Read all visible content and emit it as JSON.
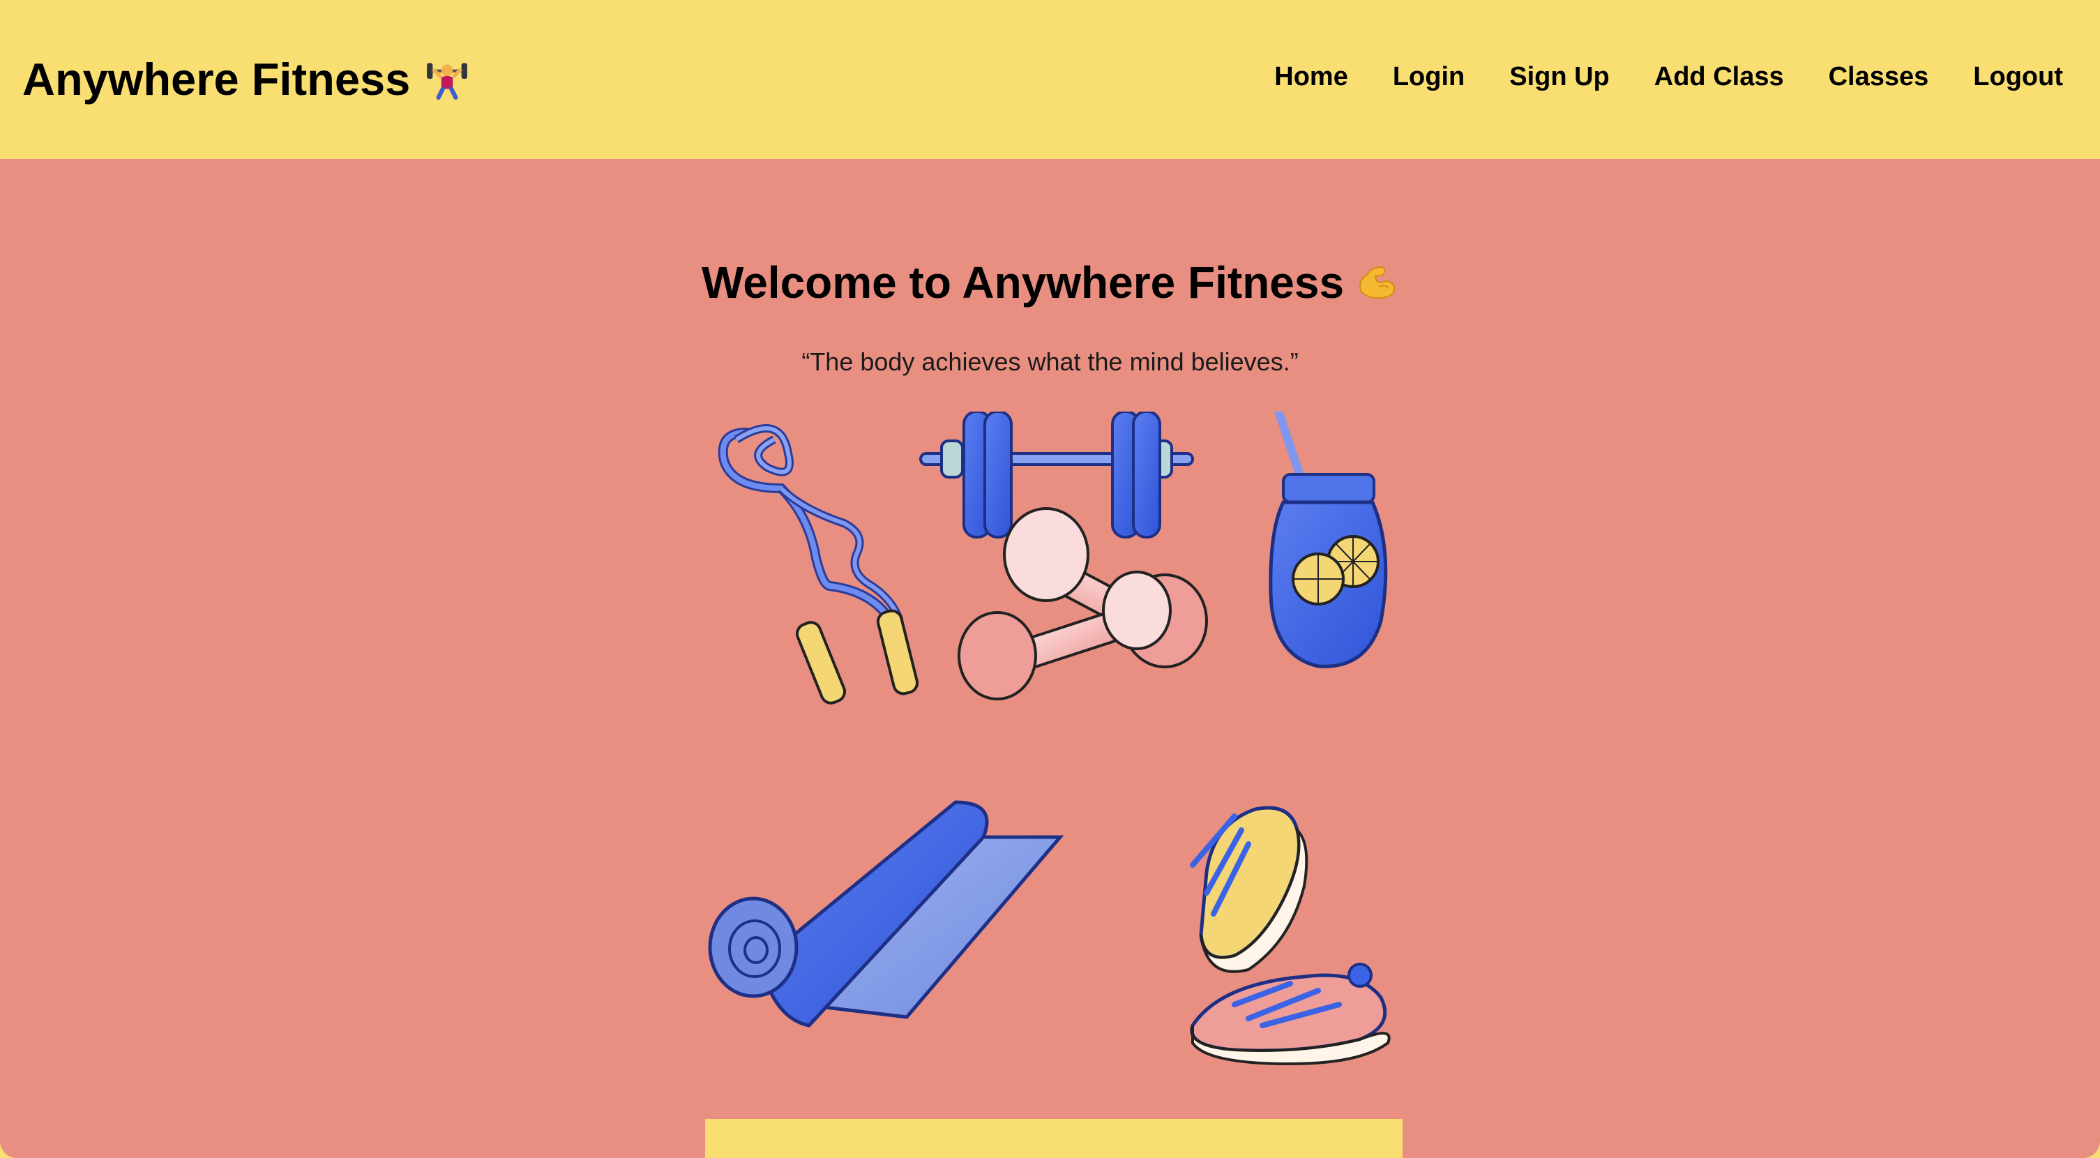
{
  "header": {
    "brand": "Anywhere Fitness",
    "brand_icon": "weightlifter-emoji",
    "nav": [
      "Home",
      "Login",
      "Sign Up",
      "Add Class",
      "Classes",
      "Logout"
    ]
  },
  "main": {
    "title": "Welcome to Anywhere Fitness",
    "title_icon": "flexed-biceps-emoji",
    "quote": "“The body achieves what the mind believes.”"
  },
  "colors": {
    "header_bg": "#f9de72",
    "main_bg": "#e98f82",
    "accent_blue": "#3b63e6",
    "accent_yellow": "#f4d774",
    "accent_pink": "#f3b2b0"
  }
}
